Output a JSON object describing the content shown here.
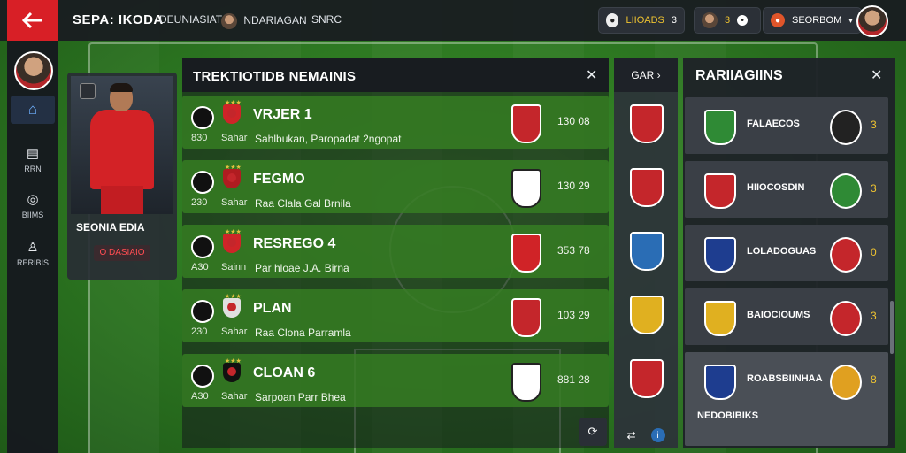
{
  "topbar": {
    "brand": "SEPA: IKODA",
    "nav": [
      "DEUNIASIAT",
      "NDARIAGAN",
      "SNRC"
    ],
    "coins": {
      "label": "LIIOADS",
      "value": "3"
    },
    "gems": {
      "value": "3"
    },
    "club": {
      "label": "SEORBOM"
    }
  },
  "sidebar": {
    "items": [
      {
        "label": "RRN",
        "icon": "document-icon"
      },
      {
        "label": "BIIMS",
        "icon": "target-icon"
      },
      {
        "label": "RERIBIS",
        "icon": "person-icon"
      }
    ]
  },
  "player": {
    "name": "SEONIA EDIA",
    "tag": "O DASIAIO"
  },
  "transfers": {
    "title": "TREKTIOTIDB NEMAINIS",
    "rows": [
      {
        "name": "VRJER 1",
        "n1": "830",
        "n2": "Sahar",
        "desc": "Sahlbukan, Paropadat 2ngopat",
        "price": "130 08",
        "crest_color": "#cf2428",
        "shield_color": "#c4262b"
      },
      {
        "name": "FEGMO",
        "n1": "230",
        "n2": "Sahar",
        "desc": "Raa Clala Gal Brnila",
        "price": "130 29",
        "crest_color": "#b01c20",
        "shield_color": "#ffffff"
      },
      {
        "name": "RESREGO 4",
        "n1": "A30",
        "n2": "Sainn",
        "desc": "Par hloae J.A. Birna",
        "price": "353 78",
        "crest_color": "#cf2428",
        "shield_color": "#d02327"
      },
      {
        "name": "PLAN",
        "n1": "230",
        "n2": "Sahar",
        "desc": "Raa Clona Parramla",
        "price": "103 29",
        "crest_color": "#e0e0e0",
        "shield_color": "#c4262b"
      },
      {
        "name": "CLOAN 6",
        "n1": "A30",
        "n2": "Sahar",
        "desc": "Sarpoan Parr Bhea",
        "price": "881 28",
        "crest_color": "#111111",
        "shield_color": "#ffffff"
      }
    ]
  },
  "middle": {
    "label": "GAR",
    "colors": [
      "#c4262b",
      "#c4262b",
      "#2a6db5",
      "#e0b020",
      "#c4262b"
    ]
  },
  "rankings": {
    "title": "RARIIAGIINS",
    "rows": [
      {
        "team": "FALAECOS",
        "value": "3",
        "c1": "#2f8a35",
        "c2": "#222222"
      },
      {
        "team": "HIIOCOSDIN",
        "value": "3",
        "c1": "#c4262b",
        "c2": "#2f8a35"
      },
      {
        "team": "LOLADOGUAS",
        "value": "0",
        "c1": "#1e3d8f",
        "c2": "#c4262b"
      },
      {
        "team": "BAIOCIOUMS",
        "value": "3",
        "c1": "#e0b020",
        "c2": "#c4262b"
      },
      {
        "team": "ROABSBIINHAA",
        "value": "8",
        "c1": "#1e3d8f",
        "c2": "#e0a020",
        "sub": "NEDOBIBIKS"
      }
    ]
  }
}
